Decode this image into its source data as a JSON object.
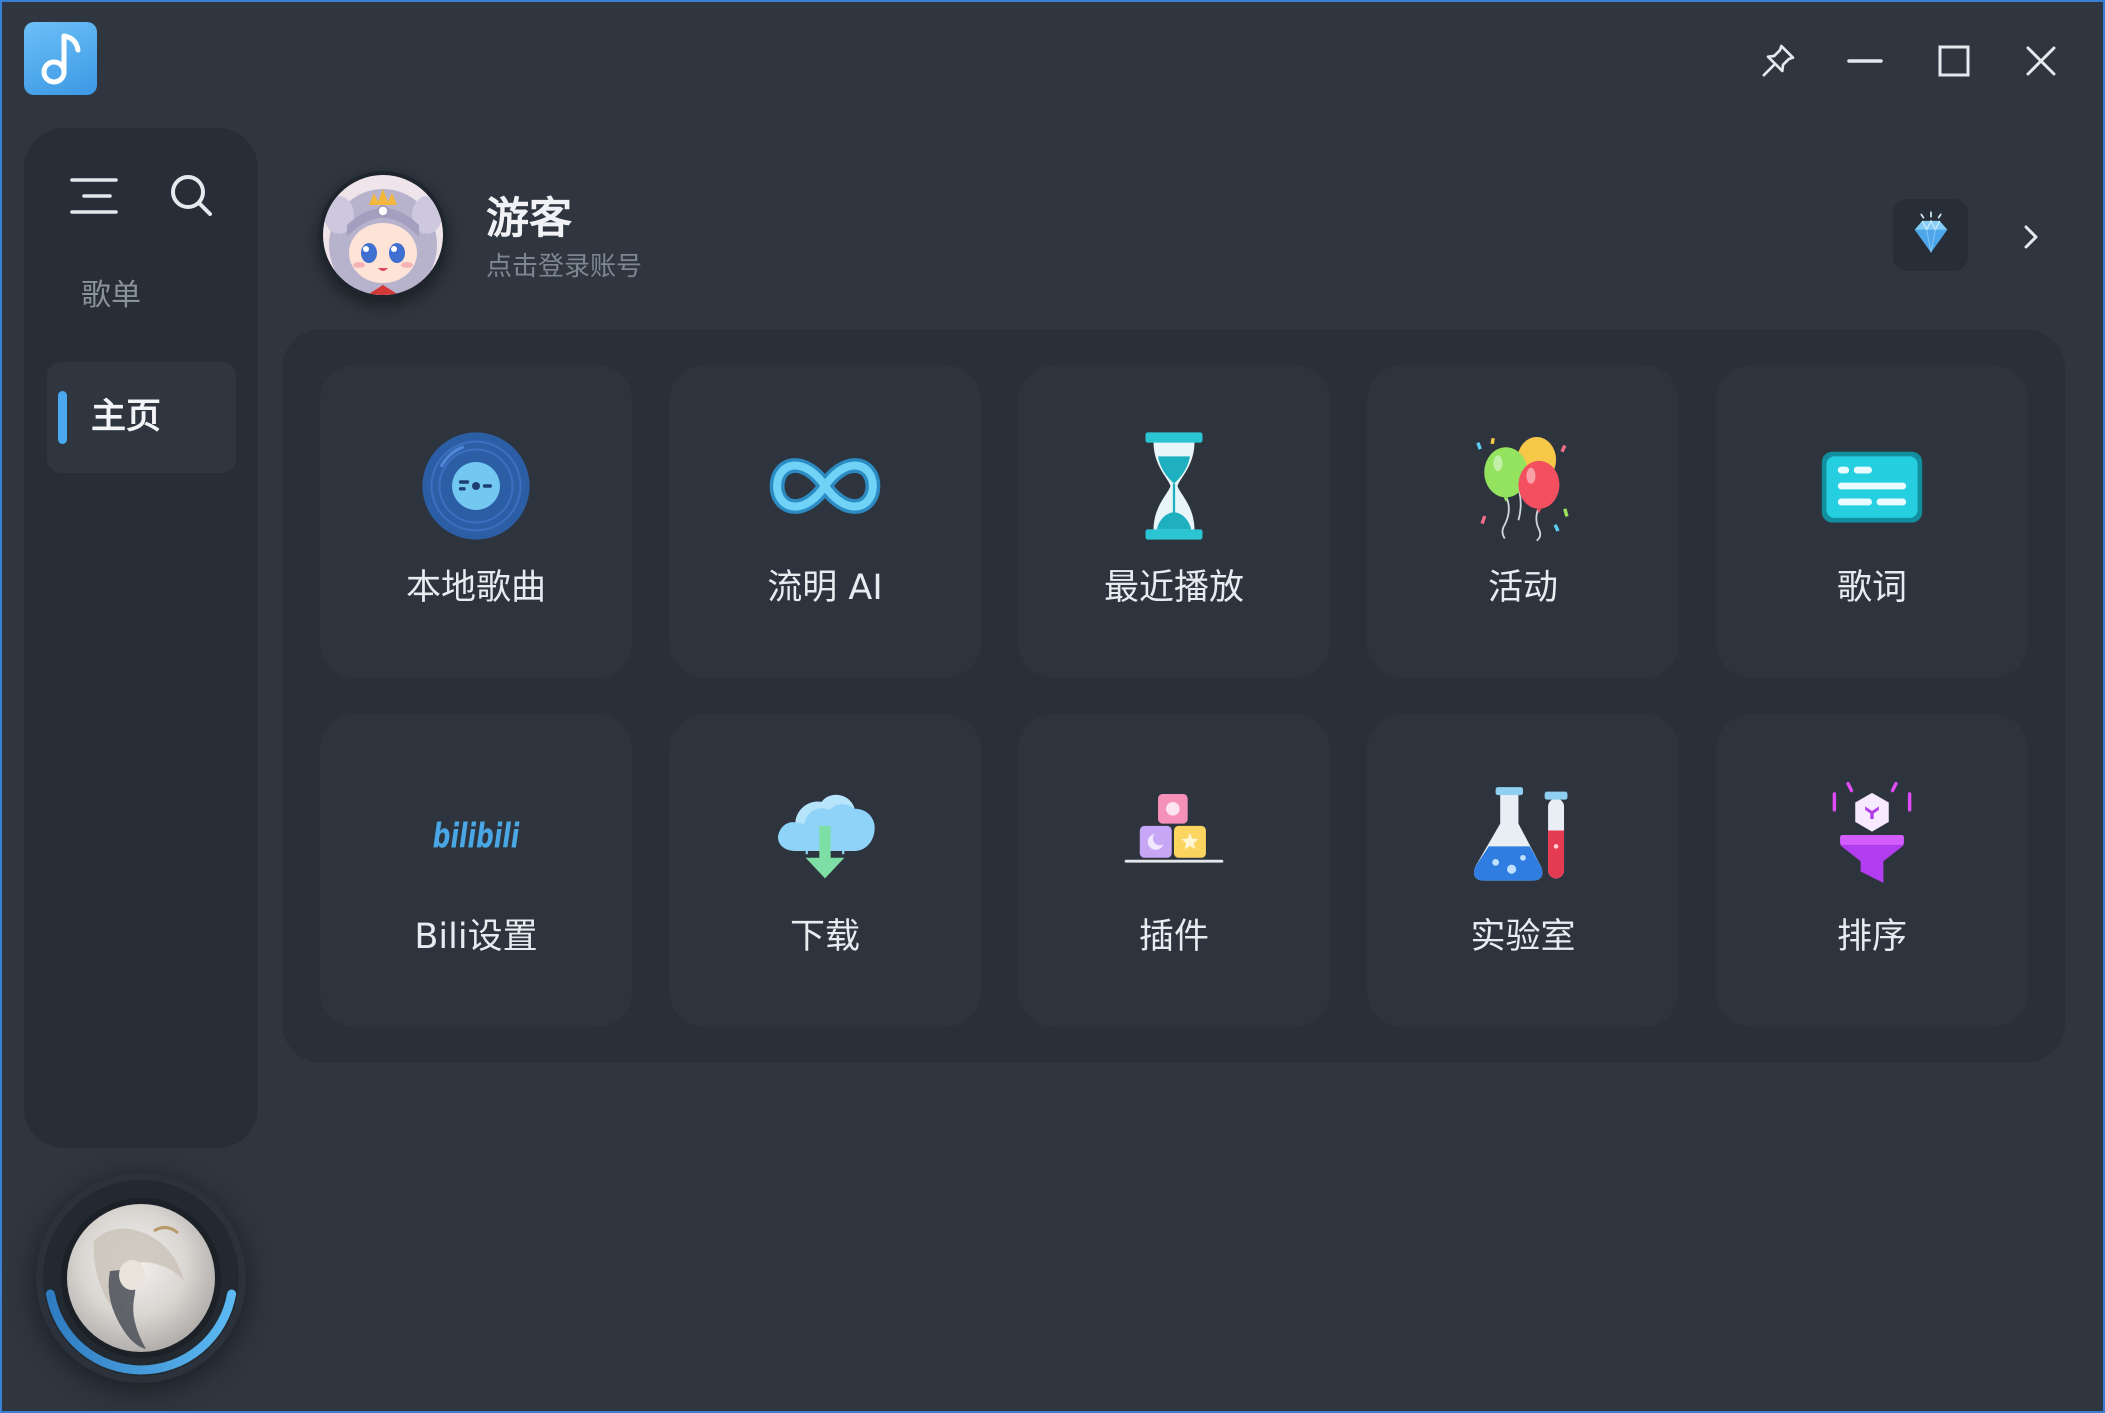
{
  "theme": {
    "background": "#2f363f",
    "sidebar": "#282e37",
    "panel": "#2a3039",
    "card": "#2d343d",
    "accent": "#4aa8f0",
    "text": "#e8ebf0",
    "muted": "#7e8691"
  },
  "app": {
    "logo_icon": "music-note-icon"
  },
  "window_controls": [
    {
      "icon": "pin-icon"
    },
    {
      "icon": "minimize-icon"
    },
    {
      "icon": "maximize-icon"
    },
    {
      "icon": "close-icon"
    }
  ],
  "sidebar": {
    "menu_icon": "menu-icon",
    "search_icon": "search-icon",
    "section_label": "歌单",
    "items": [
      {
        "label": "主页",
        "active": true
      }
    ]
  },
  "user": {
    "name": "游客",
    "subtitle": "点击登录账号",
    "avatar": "avatar-image",
    "vip_icon": "diamond-icon",
    "more_icon": "chevron-right-icon"
  },
  "features": [
    {
      "label": "本地歌曲",
      "icon": "vinyl-disc-icon"
    },
    {
      "label": "流明 AI",
      "icon": "infinity-icon"
    },
    {
      "label": "最近播放",
      "icon": "hourglass-icon"
    },
    {
      "label": "活动",
      "icon": "balloons-icon"
    },
    {
      "label": "歌词",
      "icon": "lyrics-screen-icon"
    },
    {
      "label": "Bili设置",
      "icon": "bilibili-logo-icon",
      "logo_text": "bilibili"
    },
    {
      "label": "下载",
      "icon": "cloud-download-icon"
    },
    {
      "label": "插件",
      "icon": "blocks-icon"
    },
    {
      "label": "实验室",
      "icon": "lab-flask-icon"
    },
    {
      "label": "排序",
      "icon": "funnel-sort-icon"
    }
  ],
  "player": {
    "cover": "album-cover-image"
  }
}
